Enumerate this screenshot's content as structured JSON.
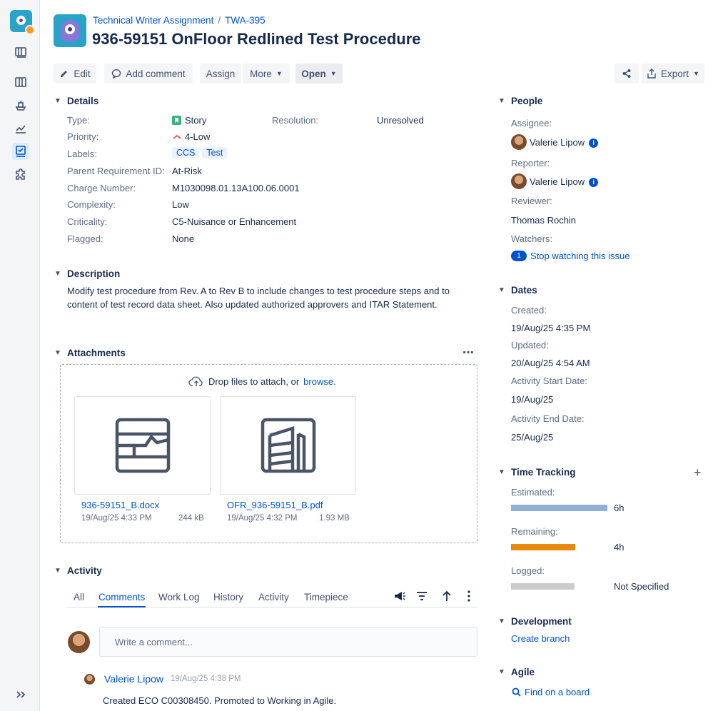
{
  "project": {
    "name": "Technical Writer Assignment",
    "issue_key": "TWA-395"
  },
  "issue": {
    "title": "936-59151 OnFloor Redlined Test Procedure"
  },
  "toolbar": {
    "edit": "Edit",
    "add_comment": "Add comment",
    "assign": "Assign",
    "more": "More",
    "status": "Open",
    "export": "Export"
  },
  "details": {
    "heading": "Details",
    "type_label": "Type:",
    "type_value": "Story",
    "resolution_label": "Resolution:",
    "resolution_value": "Unresolved",
    "priority_label": "Priority:",
    "priority_value": "4-Low",
    "labels_label": "Labels:",
    "labels": [
      "CCS",
      "Test"
    ],
    "parent_req_label": "Parent Requirement ID:",
    "parent_req_value": "At-Risk",
    "charge_label": "Charge Number:",
    "charge_value": "M1030098.01.13A100.06.0001",
    "complexity_label": "Complexity:",
    "complexity_value": "Low",
    "criticality_label": "Criticality:",
    "criticality_value": "C5-Nuisance or Enhancement",
    "flagged_label": "Flagged:",
    "flagged_value": "None"
  },
  "description": {
    "heading": "Description",
    "text": "Modify test procedure from Rev. A to Rev B to include changes to test procedure steps and to content of test record data sheet. Also updated authorized approvers and ITAR Statement."
  },
  "attachments": {
    "heading": "Attachments",
    "drop_text": "Drop files to attach, or",
    "browse": "browse.",
    "files": [
      {
        "name": "936-59151_B.docx",
        "date": "19/Aug/25 4:33 PM",
        "size": "244 kB"
      },
      {
        "name": "OFR_936-59151_B.pdf",
        "date": "19/Aug/25 4:32 PM",
        "size": "1.93 MB"
      }
    ]
  },
  "activity": {
    "heading": "Activity",
    "tabs": [
      "All",
      "Comments",
      "Work Log",
      "History",
      "Activity",
      "Timepiece"
    ],
    "comment_placeholder": "Write a comment...",
    "entries": [
      {
        "author": "Valerie Lipow",
        "time": "19/Aug/25 4:38 PM",
        "text": "Created ECO C00308450. Promoted to Working in Agile."
      }
    ]
  },
  "people": {
    "heading": "People",
    "assignee_label": "Assignee:",
    "assignee": "Valerie Lipow",
    "reporter_label": "Reporter:",
    "reporter": "Valerie Lipow",
    "reviewer_label": "Reviewer:",
    "reviewer": "Thomas Rochin",
    "watchers_label": "Watchers:",
    "watchers_count": "1",
    "stop_watching": "Stop watching this issue"
  },
  "dates": {
    "heading": "Dates",
    "created_label": "Created:",
    "created": "19/Aug/25 4:35 PM",
    "updated_label": "Updated:",
    "updated": "20/Aug/25 4:54 AM",
    "start_label": "Activity Start Date:",
    "start": "19/Aug/25",
    "end_label": "Activity End Date:",
    "end": "25/Aug/25"
  },
  "time_tracking": {
    "heading": "Time Tracking",
    "estimated_label": "Estimated:",
    "estimated": "6h",
    "estimated_fraction": 1.0,
    "remaining_label": "Remaining:",
    "remaining": "4h",
    "remaining_fraction": 0.667,
    "logged_label": "Logged:",
    "logged": "Not Specified",
    "logged_fraction": 0.0
  },
  "development": {
    "heading": "Development",
    "create_branch": "Create branch"
  },
  "agile": {
    "heading": "Agile",
    "find_on_board": "Find on a board"
  },
  "colors": {
    "link": "#0052cc",
    "estimated_bar": "#8fb0d9",
    "remaining_bar": "#e8890c",
    "logged_bar": "#cccccc",
    "story_green": "#36b37e",
    "priority_low": "#ff5630"
  }
}
